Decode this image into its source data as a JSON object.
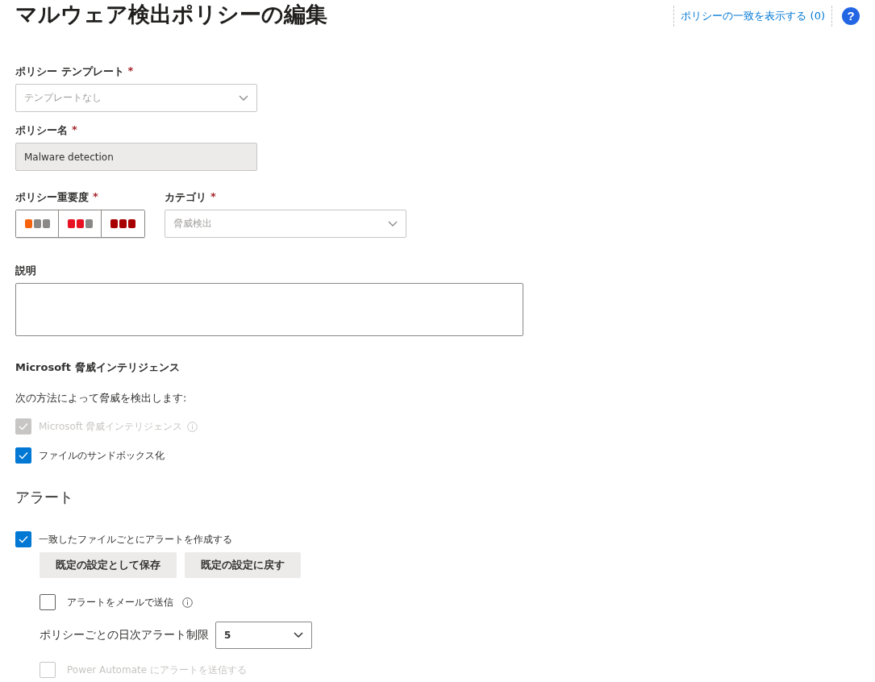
{
  "title": "マルウェア検出ポリシーの編集",
  "header_link": {
    "label": "ポリシーの一致を表示する (0)"
  },
  "help_button": {
    "label": "?"
  },
  "policy_template": {
    "label": "ポリシー テンプレート",
    "required_mark": "*",
    "value": "テンプレートなし"
  },
  "policy_name": {
    "label": "ポリシー名",
    "required_mark": "*",
    "value": "Malware detection",
    "disabled": true
  },
  "severity": {
    "label": "ポリシー重要度",
    "required_mark": "*",
    "options": [
      {
        "kind": "low",
        "selected": false
      },
      {
        "kind": "medium",
        "selected": false
      },
      {
        "kind": "high",
        "selected": false
      }
    ]
  },
  "category": {
    "label": "カテゴリ",
    "required_mark": "*",
    "value": "脅威検出"
  },
  "description": {
    "label": "説明"
  },
  "threat_intel": {
    "heading": "Microsoft 脅威インテリジェンス",
    "intro": "次の方法によって脅威を検出します:",
    "options": [
      {
        "label": "Microsoft 脅威インテリジェンス",
        "checked": true,
        "disabled": true,
        "info": true
      },
      {
        "label": "ファイルのサンドボックス化",
        "checked": true,
        "disabled": false
      }
    ]
  },
  "alerts": {
    "heading": "アラート",
    "create_alert": {
      "label": "一致したファイルごとにアラートを作成する",
      "checked": true,
      "disabled": false
    },
    "buttons": [
      "既定の設定として保存",
      "既定の設定に戻す"
    ],
    "email": {
      "label": "アラートをメールで送信",
      "checked": false,
      "disabled": false,
      "info": true
    },
    "daily_limit": {
      "label": "ポリシーごとの日次アラート制限",
      "value": "5"
    },
    "power_automate": {
      "label": "Power Automate にアラートを送信する",
      "checked": false,
      "disabled": true
    }
  }
}
